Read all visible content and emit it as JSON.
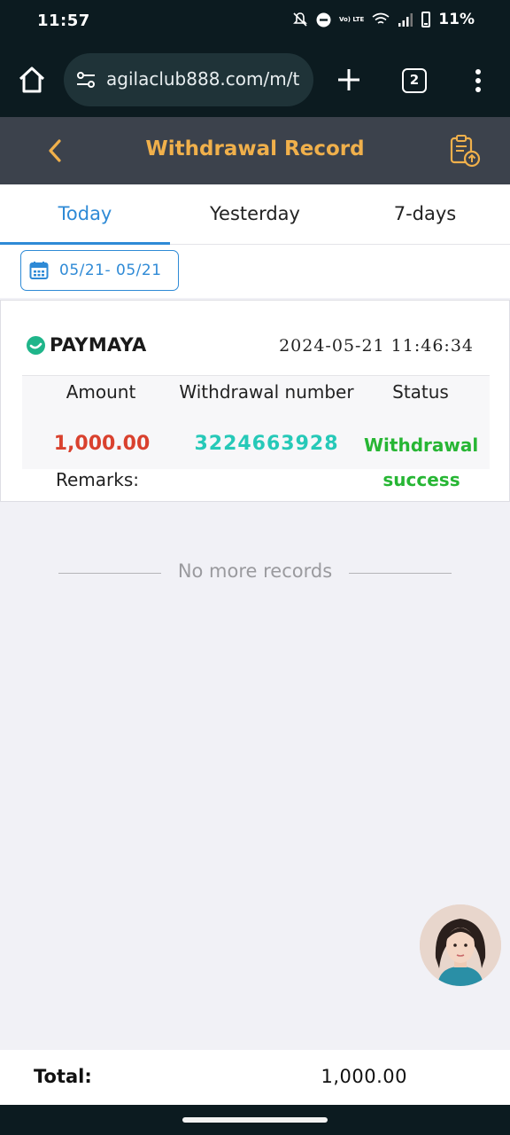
{
  "status_bar": {
    "time": "11:57",
    "network_label": "Vo) LTE",
    "battery_text": "11%"
  },
  "browser": {
    "url": "agilaclub888.com/m/t",
    "tab_count": "2"
  },
  "header": {
    "title": "Withdrawal Record"
  },
  "tabs": [
    {
      "label": "Today",
      "active": true
    },
    {
      "label": "Yesterday",
      "active": false
    },
    {
      "label": "7-days",
      "active": false
    }
  ],
  "date_filter": {
    "range": "05/21- 05/21"
  },
  "record": {
    "method": "PAYMAYA",
    "datetime": "2024-05-21 11:46:34",
    "headers": {
      "amount": "Amount",
      "number": "Withdrawal number",
      "status": "Status"
    },
    "amount": "1,000.00",
    "withdrawal_number": "3224663928",
    "status_line1": "Withdrawal",
    "status_line2": "success",
    "remarks_label": "Remarks:"
  },
  "no_more": "No more records",
  "footer": {
    "label": "Total:",
    "total": "1,000.00"
  },
  "colors": {
    "accent_blue": "#2e8ad6",
    "title_gold": "#f0b04b",
    "amount_red": "#d9412e",
    "number_teal": "#26c9b8",
    "success_green": "#27b634"
  }
}
